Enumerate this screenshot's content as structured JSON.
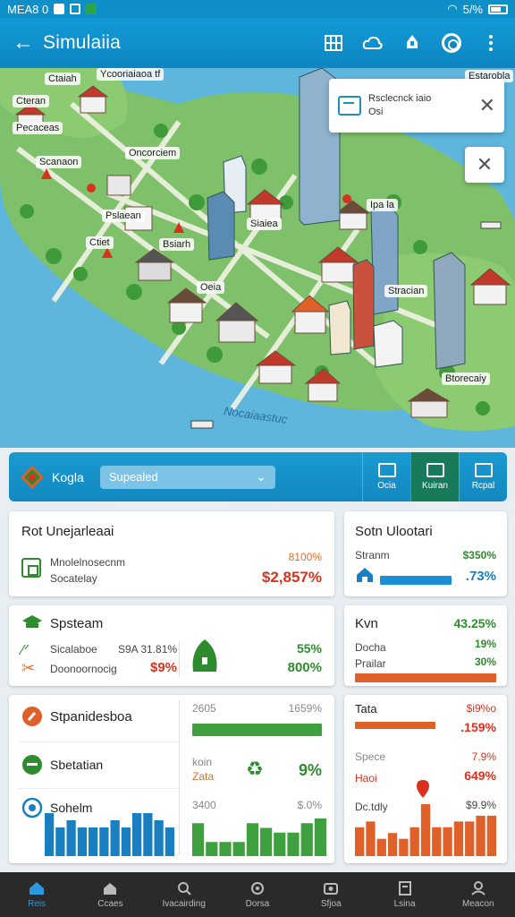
{
  "status": {
    "time": "MEA8 0",
    "signal": "5/%"
  },
  "appbar": {
    "title": "Simulaiia",
    "back_icon": "arrow-left-icon",
    "actions": [
      "grid-icon",
      "cloud-icon",
      "bell-icon",
      "target-icon",
      "more-vertical-icon"
    ]
  },
  "map": {
    "labels": [
      "Ctaiah",
      "Ycooriaiaoa tf",
      "Cteran",
      "Pecaceas",
      "Scanaon",
      "Oncorciem",
      "Pslaean",
      "Ctiet",
      "Bsiarh",
      "Siaiea",
      "Ipa la",
      "Oeia",
      "Btorecaiy",
      "Stracian",
      "Estarobla"
    ],
    "water_label": "Nocaiaastuc"
  },
  "popup": {
    "title": "Rsclecnck iaio",
    "subtitle": "Osi"
  },
  "strip": {
    "title": "Kogla",
    "selected": "Supealed",
    "tabs": [
      "Ocia",
      "Kuiran",
      "Rcpal"
    ]
  },
  "card1": {
    "title": "Rot Unejarleaai",
    "row1": "Mnolelnosecnm",
    "row2": "Socatelay",
    "pct": "8100%",
    "value": "$2,857%"
  },
  "card2": {
    "title": "Sotn Ulootari",
    "label": "Stranm",
    "pct": "$350%",
    "value": ".73%"
  },
  "card3": {
    "title": "Spsteam",
    "row1": "Sicalaboe",
    "row1_val": "S9A 31.81%",
    "row2": "Doonoornocig",
    "row2_val": "$9%",
    "pct": "55%",
    "value": "800%"
  },
  "card4": {
    "title": "Kvn",
    "pct": "43.25%",
    "row1": "Docha",
    "row1_val": "19%",
    "row2": "Prailar",
    "row2_val": "30%"
  },
  "card5": {
    "row1": "Stpanidesboa",
    "row1_left": "2605",
    "row1_right": "1659%",
    "row2": "Sbetatian",
    "row2_left": "koin",
    "row2_left2": "Zata",
    "row2_val": "9%",
    "row3": "Sohelm",
    "row3_left": "3400",
    "row3_right": "$.0%"
  },
  "card6": {
    "row1": "Tata",
    "row1_val": "$i9%o",
    "row2_val": ".159%",
    "row3": "Spece",
    "row3_val": "7.9%",
    "row4": "Haoi",
    "row4_val": "649%",
    "row5": "Dc.tdly",
    "row5_val": "$9.9%"
  },
  "chart_blue": {
    "type": "bar",
    "values": [
      6,
      4,
      5,
      4,
      4,
      4,
      5,
      4,
      6,
      6,
      5,
      4
    ]
  },
  "chart_green": {
    "type": "bar",
    "values": [
      7,
      3,
      3,
      3,
      7,
      6,
      5,
      5,
      7,
      8
    ]
  },
  "chart_orange": {
    "type": "bar",
    "values": [
      5,
      6,
      3,
      4,
      3,
      5,
      9,
      5,
      5,
      6,
      6,
      7,
      7
    ]
  },
  "nav": [
    "Reis",
    "Ccaes",
    "Ivacairding",
    "Dorsa",
    "Sfjoa",
    "Lsina",
    "Meacon"
  ],
  "colors": {
    "primary": "#129ad6",
    "green": "#2e8b2e",
    "red": "#d8321e",
    "orange": "#e0602a",
    "blue": "#1a7fc0"
  }
}
